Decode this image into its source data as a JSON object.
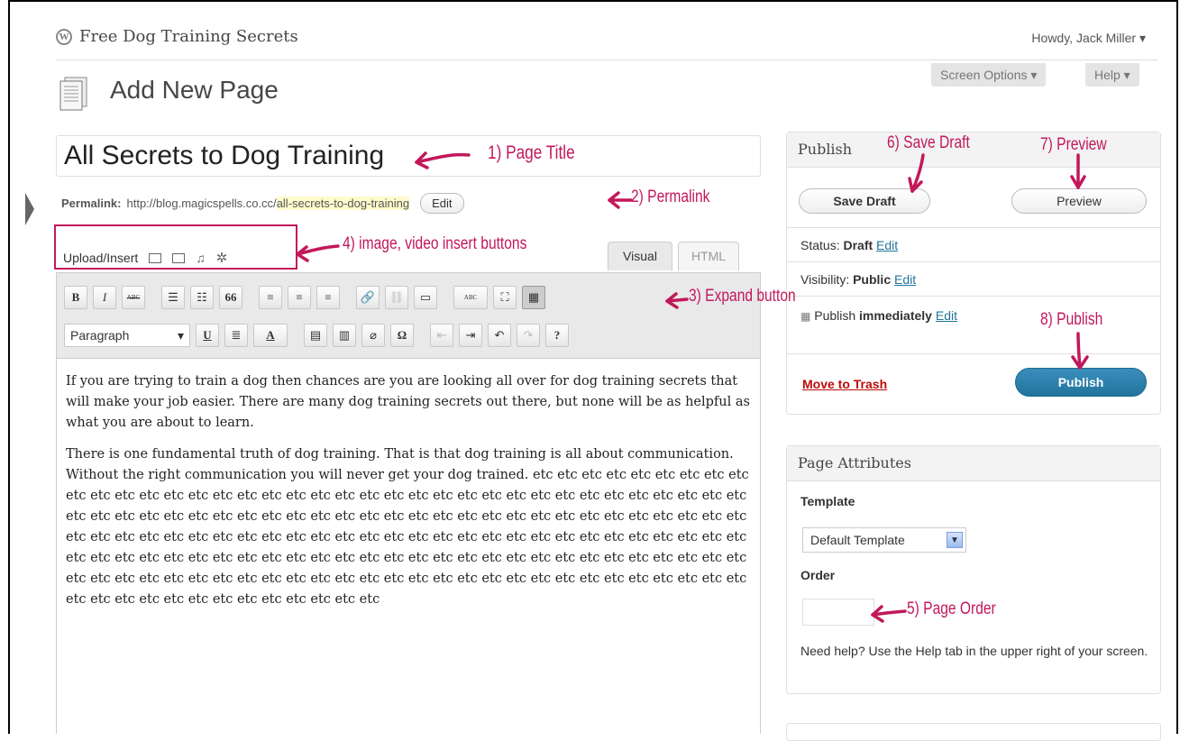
{
  "header": {
    "site_title": "Free Dog Training Secrets",
    "howdy": "Howdy, Jack Miller ▾",
    "screen_options": "Screen Options ▾",
    "help": "Help ▾"
  },
  "page": {
    "heading": "Add New Page",
    "title_value": "All Secrets to Dog Training",
    "permalink_label": "Permalink:",
    "permalink_base": "http://blog.magicspells.co.cc/",
    "permalink_slug": "all-secrets-to-dog-training",
    "permalink_edit": "Edit"
  },
  "editor": {
    "upload_insert": "Upload/Insert",
    "tab_visual": "Visual",
    "tab_html": "HTML",
    "format_select": "Paragraph",
    "toolbar_row1": [
      "B",
      "I",
      "ABC",
      "☰",
      "☷",
      "66",
      "≡",
      "≡",
      "≡",
      "🔗",
      "⛓",
      "▭",
      "ABC",
      "⛶",
      "▦"
    ],
    "toolbar_row2": [
      "U",
      "≣",
      "A",
      "▤",
      "▥",
      "⌀",
      "Ω",
      "⇤",
      "⇥",
      "↶",
      "↷",
      "?"
    ],
    "paragraphs": [
      "If you are trying to train a dog then chances are you are looking all over for dog training secrets that will make your job easier. There are many dog training secrets out there, but none will be as helpful as what you are about to learn.",
      "There is one fundamental truth of dog training. That is that dog training is all about communication. Without the right communication you will never get your dog trained. etc etc etc etc etc etc etc etc etc etc etc etc etc etc etc etc etc etc etc etc etc etc etc etc etc etc etc etc etc etc etc etc etc etc etc etc etc etc etc etc etc etc etc etc etc etc etc etc etc etc etc etc etc etc etc etc etc etc etc etc etc etc etc etc etc etc etc etc etc etc etc etc etc etc etc etc etc etc etc etc etc etc etc etc etc etc etc etc etc etc etc etc etc etc etc etc etc etc etc etc etc etc etc etc etc etc etc etc etc etc etc etc etc etc etc etc etc etc etc etc etc etc etc etc etc etc etc etc etc etc etc etc etc etc etc etc etc etc etc etc etc etc etc etc etc etc etc etc etc etc etc etc etc etc etc etc etc etc etc etc etc etc"
    ]
  },
  "publish": {
    "heading": "Publish",
    "save_draft": "Save Draft",
    "preview": "Preview",
    "status_label": "Status:",
    "status_value": "Draft",
    "visibility_label": "Visibility:",
    "visibility_value": "Public",
    "publish_label": "Publish",
    "publish_value": "immediately",
    "edit": "Edit",
    "move_to_trash": "Move to Trash",
    "publish_button": "Publish"
  },
  "attributes": {
    "heading": "Page Attributes",
    "template_label": "Template",
    "template_value": "Default Template",
    "order_label": "Order",
    "help_text": "Need help? Use the Help tab in the upper right of your screen."
  },
  "annotations": {
    "page_title": "1) Page Title",
    "permalink": "2) Permalink",
    "expand": "3) Expand button",
    "insert": "4) image, video insert buttons",
    "page_order": "5) Page Order",
    "save_draft": "6) Save Draft",
    "preview": "7) Preview",
    "publish": "8) Publish"
  },
  "colors": {
    "annotation": "#c2185b",
    "link": "#21759b",
    "publish_button": "#21759b",
    "trash": "#bc0b0b"
  }
}
